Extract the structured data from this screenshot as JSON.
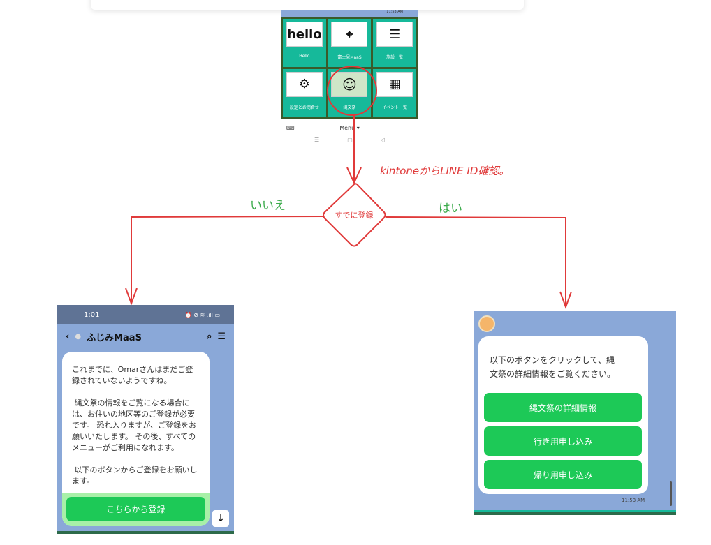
{
  "menu_screenshot": {
    "time": "11:53 AM",
    "tiles": [
      {
        "icon": "hello-logo",
        "image_text": "hello",
        "label": "Hello"
      },
      {
        "icon": "map-pin-icon",
        "label": "富士見MaaS"
      },
      {
        "icon": "list-icon",
        "label": "施設一覧"
      },
      {
        "icon": "gear-search-icon",
        "label": "設定とお問合せ"
      },
      {
        "icon": "jomon-character-image",
        "label": "縄文祭"
      },
      {
        "icon": "calendar-list-icon",
        "label": "イベント一覧"
      }
    ],
    "menu_label": "Menu ▾",
    "nav": [
      "☰",
      "▢",
      "◁"
    ]
  },
  "flow": {
    "check_note": "kintoneからLINE ID確認。",
    "decision": "すでに登録",
    "no_label": "いいえ",
    "yes_label": "はい",
    "accent": "#e03a3a",
    "branch_color": "#3aaa4a"
  },
  "left_phone": {
    "time": "1:01",
    "status_icons": "⏰ ⊘ ≋ .ıll ▭",
    "chat_title": "ふじみMaaS",
    "message": "これまでに、Omarさんはまだご登録されていないようですね。\n\n 縄文祭の情報をご覧になる場合には、お住いの地区等のご登録が必要です。 恐れ入りますが、ご登録をお願いいたします。 その後、すべてのメニューがご利用になれます。\n\n 以下のボタンからご登録をお願いします。",
    "register_button": "こちらから登録"
  },
  "right_phone": {
    "message": "以下のボタンをクリックして、縄文祭の詳細情報をご覧ください。",
    "buttons": [
      "縄文祭の詳細情報",
      "行き用申し込み",
      "帰り用申し込み"
    ],
    "time": "11:53 AM"
  }
}
